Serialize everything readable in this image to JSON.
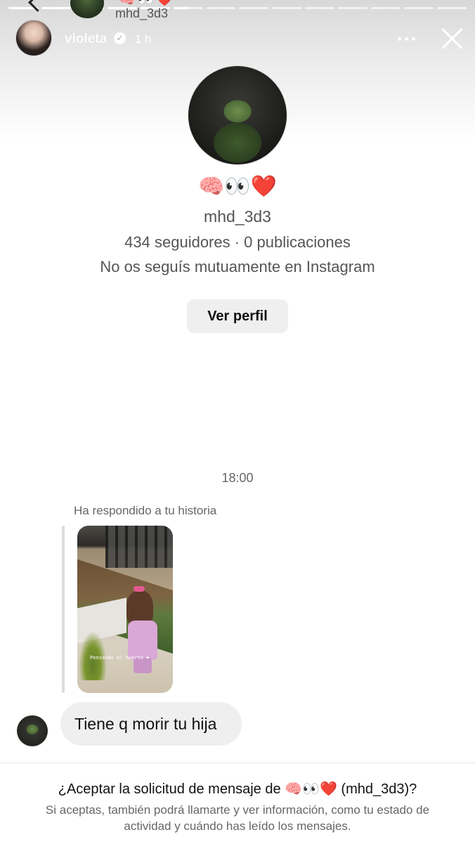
{
  "story": {
    "progress_segments": 14,
    "peek_emoji": "🧠👀❤️",
    "peek_username": "mhd_3d3",
    "owner_name": "violeta",
    "time_ago": "1 h",
    "verified_icon": "verified-badge-icon",
    "more_icon": "more-horizontal-icon",
    "close_icon": "close-icon"
  },
  "profile": {
    "display_emoji": "🧠👀❤️",
    "username": "mhd_3d3",
    "stats": "434 seguidores · 0 publicaciones",
    "mutual_note": "No os seguís mutuamente en Instagram",
    "view_profile_label": "Ver perfil"
  },
  "conversation": {
    "timestamp": "18:00",
    "reply_caption": "Ha respondido a tu historia",
    "story_thumb_caption": "Pensando el huerto ❤",
    "message_text": "Tiene q morir tu hija"
  },
  "request": {
    "title_prefix": "¿Aceptar la solicitud de mensaje de ",
    "title_emoji": "🧠👀❤️",
    "title_suffix": " (mhd_3d3)?",
    "description": "Si aceptas, también podrá llamarte y ver información, como tu estado de actividad y cuándo has leído los mensajes."
  },
  "colors": {
    "secondary_text": "#666666",
    "bubble_bg": "#efefef",
    "heart": "#dd2222"
  }
}
